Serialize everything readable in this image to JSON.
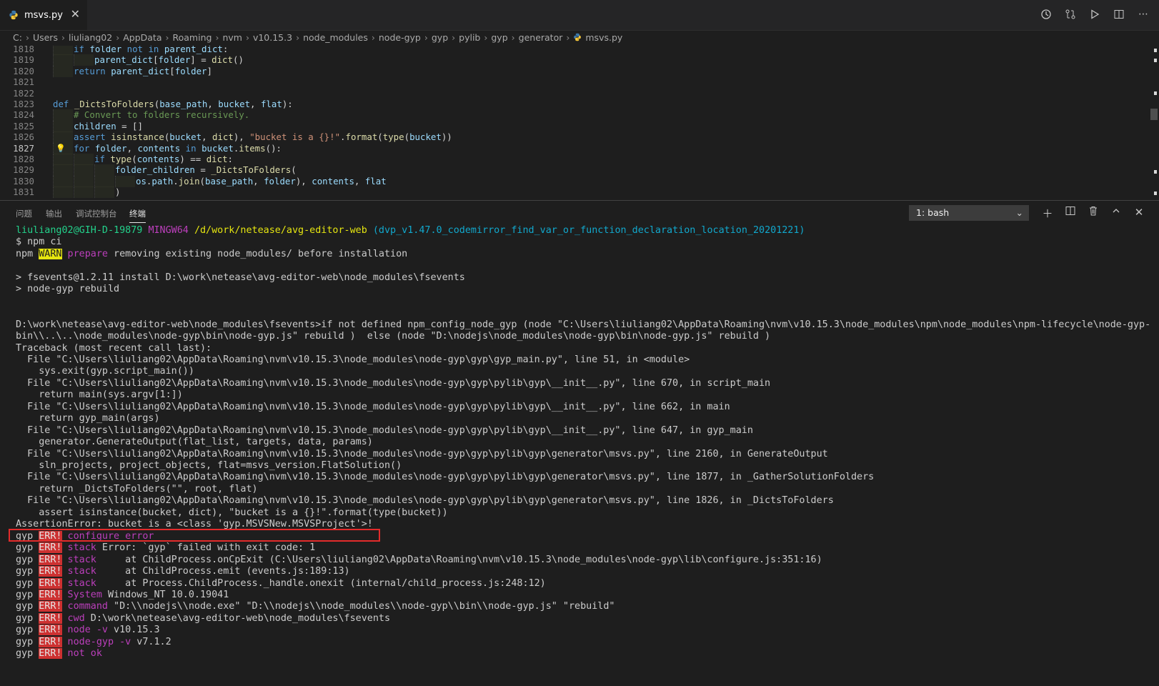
{
  "tab": {
    "file_name": "msvs.py",
    "close": "✕"
  },
  "breadcrumb": [
    "C:",
    "Users",
    "liuliang02",
    "AppData",
    "Roaming",
    "nvm",
    "v10.15.3",
    "node_modules",
    "node-gyp",
    "gyp",
    "pylib",
    "gyp",
    "generator",
    "msvs.py"
  ],
  "editor": {
    "lines": [
      {
        "n": "1818",
        "tokens": [
          [
            "kw",
            "if "
          ],
          [
            "id",
            "folder "
          ],
          [
            "kw",
            "not in "
          ],
          [
            "id",
            "parent_dict"
          ],
          [
            "op",
            ":"
          ]
        ],
        "indent": 1
      },
      {
        "n": "1819",
        "tokens": [
          [
            "id",
            "parent_dict"
          ],
          [
            "op",
            "["
          ],
          [
            "id",
            "folder"
          ],
          [
            "op",
            "] = "
          ],
          [
            "fn",
            "dict"
          ],
          [
            "op",
            "()"
          ]
        ],
        "indent": 2
      },
      {
        "n": "1820",
        "tokens": [
          [
            "kw",
            "return "
          ],
          [
            "id",
            "parent_dict"
          ],
          [
            "op",
            "["
          ],
          [
            "id",
            "folder"
          ],
          [
            "op",
            "]"
          ]
        ],
        "indent": 1
      },
      {
        "n": "1821",
        "tokens": [],
        "indent": 0
      },
      {
        "n": "1822",
        "tokens": [],
        "indent": 0
      },
      {
        "n": "1823",
        "tokens": [
          [
            "kw",
            "def "
          ],
          [
            "fn",
            "_DictsToFolders"
          ],
          [
            "op",
            "("
          ],
          [
            "id",
            "base_path"
          ],
          [
            "op",
            ", "
          ],
          [
            "id",
            "bucket"
          ],
          [
            "op",
            ", "
          ],
          [
            "id",
            "flat"
          ],
          [
            "op",
            "):"
          ]
        ],
        "indent": 0
      },
      {
        "n": "1824",
        "tokens": [
          [
            "cm",
            "# Convert to folders recursively."
          ]
        ],
        "indent": 1
      },
      {
        "n": "1825",
        "tokens": [
          [
            "id",
            "children "
          ],
          [
            "op",
            "= []"
          ]
        ],
        "indent": 1
      },
      {
        "n": "1826",
        "tokens": [
          [
            "kw",
            "assert "
          ],
          [
            "fn",
            "isinstance"
          ],
          [
            "op",
            "("
          ],
          [
            "id",
            "bucket"
          ],
          [
            "op",
            ", "
          ],
          [
            "fn",
            "dict"
          ],
          [
            "op",
            "), "
          ],
          [
            "str",
            "\"bucket is a {}!\""
          ],
          [
            "op",
            "."
          ],
          [
            "fn",
            "format"
          ],
          [
            "op",
            "("
          ],
          [
            "fn",
            "type"
          ],
          [
            "op",
            "("
          ],
          [
            "id",
            "bucket"
          ],
          [
            "op",
            "))"
          ]
        ],
        "indent": 1
      },
      {
        "n": "1827",
        "tokens": [
          [
            "kw",
            "for "
          ],
          [
            "id",
            "folder"
          ],
          [
            "op",
            ", "
          ],
          [
            "id",
            "contents "
          ],
          [
            "kw",
            "in "
          ],
          [
            "id",
            "bucket"
          ],
          [
            "op",
            "."
          ],
          [
            "fn",
            "items"
          ],
          [
            "op",
            "():"
          ]
        ],
        "indent": 1,
        "active": true
      },
      {
        "n": "1828",
        "tokens": [
          [
            "kw",
            "if "
          ],
          [
            "fn",
            "type"
          ],
          [
            "op",
            "("
          ],
          [
            "id",
            "contents"
          ],
          [
            "op",
            ") == "
          ],
          [
            "fn",
            "dict"
          ],
          [
            "op",
            ":"
          ]
        ],
        "indent": 2
      },
      {
        "n": "1829",
        "tokens": [
          [
            "id",
            "folder_children "
          ],
          [
            "op",
            "= "
          ],
          [
            "fn",
            "_DictsToFolders"
          ],
          [
            "op",
            "("
          ]
        ],
        "indent": 3
      },
      {
        "n": "1830",
        "tokens": [
          [
            "id",
            "os"
          ],
          [
            "op",
            "."
          ],
          [
            "id",
            "path"
          ],
          [
            "op",
            "."
          ],
          [
            "fn",
            "join"
          ],
          [
            "op",
            "("
          ],
          [
            "id",
            "base_path"
          ],
          [
            "op",
            ", "
          ],
          [
            "id",
            "folder"
          ],
          [
            "op",
            "), "
          ],
          [
            "id",
            "contents"
          ],
          [
            "op",
            ", "
          ],
          [
            "id",
            "flat"
          ]
        ],
        "indent": 4
      },
      {
        "n": "1831",
        "tokens": [
          [
            "op",
            ")"
          ]
        ],
        "indent": 3
      }
    ]
  },
  "panel": {
    "tabs": [
      "问题",
      "输出",
      "调试控制台",
      "终端"
    ],
    "active_tab": "终端",
    "terminal_select": "1: bash"
  },
  "terminal": {
    "lines": [
      [
        [
          "green",
          "liuliang02@GIH-D-19879 "
        ],
        [
          "mag",
          "MINGW64 "
        ],
        [
          "yel",
          "/d/work/netease/avg-editor-web "
        ],
        [
          "cyan",
          "(dvp_v1.47.0_codemirror_find_var_or_function_declaration_location_20201221)"
        ]
      ],
      [
        [
          "",
          "$ npm ci"
        ]
      ],
      [
        [
          "",
          "npm "
        ],
        [
          "warnbg",
          "WARN"
        ],
        [
          "",
          ""
        ],
        [
          "prop",
          " prepare"
        ],
        [
          "",
          " removing existing node_modules/ before installation"
        ]
      ],
      [],
      [
        [
          "",
          "> fsevents@1.2.11 install D:\\work\\netease\\avg-editor-web\\node_modules\\fsevents"
        ]
      ],
      [
        [
          "",
          "> node-gyp rebuild"
        ]
      ],
      [],
      [],
      [
        [
          "",
          "D:\\work\\netease\\avg-editor-web\\node_modules\\fsevents>if not defined npm_config_node_gyp (node \"C:\\Users\\liuliang02\\AppData\\Roaming\\nvm\\v10.15.3\\node_modules\\npm\\node_modules\\npm-lifecycle\\node-gyp-"
        ]
      ],
      [
        [
          "",
          "bin\\\\..\\..\\node_modules\\node-gyp\\bin\\node-gyp.js\" rebuild )  else (node \"D:\\nodejs\\node_modules\\node-gyp\\bin\\node-gyp.js\" rebuild )"
        ]
      ],
      [
        [
          "",
          "Traceback (most recent call last):"
        ]
      ],
      [
        [
          "",
          "  File \"C:\\Users\\liuliang02\\AppData\\Roaming\\nvm\\v10.15.3\\node_modules\\node-gyp\\gyp\\gyp_main.py\", line 51, in <module>"
        ]
      ],
      [
        [
          "",
          "    sys.exit(gyp.script_main())"
        ]
      ],
      [
        [
          "",
          "  File \"C:\\Users\\liuliang02\\AppData\\Roaming\\nvm\\v10.15.3\\node_modules\\node-gyp\\gyp\\pylib\\gyp\\__init__.py\", line 670, in script_main"
        ]
      ],
      [
        [
          "",
          "    return main(sys.argv[1:])"
        ]
      ],
      [
        [
          "",
          "  File \"C:\\Users\\liuliang02\\AppData\\Roaming\\nvm\\v10.15.3\\node_modules\\node-gyp\\gyp\\pylib\\gyp\\__init__.py\", line 662, in main"
        ]
      ],
      [
        [
          "",
          "    return gyp_main(args)"
        ]
      ],
      [
        [
          "",
          "  File \"C:\\Users\\liuliang02\\AppData\\Roaming\\nvm\\v10.15.3\\node_modules\\node-gyp\\gyp\\pylib\\gyp\\__init__.py\", line 647, in gyp_main"
        ]
      ],
      [
        [
          "",
          "    generator.GenerateOutput(flat_list, targets, data, params)"
        ]
      ],
      [
        [
          "",
          "  File \"C:\\Users\\liuliang02\\AppData\\Roaming\\nvm\\v10.15.3\\node_modules\\node-gyp\\gyp\\pylib\\gyp\\generator\\msvs.py\", line 2160, in GenerateOutput"
        ]
      ],
      [
        [
          "",
          "    sln_projects, project_objects, flat=msvs_version.FlatSolution()"
        ]
      ],
      [
        [
          "",
          "  File \"C:\\Users\\liuliang02\\AppData\\Roaming\\nvm\\v10.15.3\\node_modules\\node-gyp\\gyp\\pylib\\gyp\\generator\\msvs.py\", line 1877, in _GatherSolutionFolders"
        ]
      ],
      [
        [
          "",
          "    return _DictsToFolders(\"\", root, flat)"
        ]
      ],
      [
        [
          "",
          "  File \"C:\\Users\\liuliang02\\AppData\\Roaming\\nvm\\v10.15.3\\node_modules\\node-gyp\\gyp\\pylib\\gyp\\generator\\msvs.py\", line 1826, in _DictsToFolders"
        ]
      ],
      [
        [
          "",
          "    assert isinstance(bucket, dict), \"bucket is a {}!\".format(type(bucket))"
        ]
      ],
      [
        [
          "",
          "AssertionError: bucket is a <class 'gyp.MSVSNew.MSVSProject'>!"
        ]
      ],
      [
        [
          "",
          "gyp "
        ],
        [
          "errbg",
          "ERR!"
        ],
        [
          "prop",
          " configure error"
        ]
      ],
      [
        [
          "",
          "gyp "
        ],
        [
          "errbg",
          "ERR!"
        ],
        [
          "prop",
          " stack"
        ],
        [
          "",
          " Error: `gyp` failed with exit code: 1"
        ]
      ],
      [
        [
          "",
          "gyp "
        ],
        [
          "errbg",
          "ERR!"
        ],
        [
          "prop",
          " stack"
        ],
        [
          "",
          "     at ChildProcess.onCpExit (C:\\Users\\liuliang02\\AppData\\Roaming\\nvm\\v10.15.3\\node_modules\\node-gyp\\lib\\configure.js:351:16)"
        ]
      ],
      [
        [
          "",
          "gyp "
        ],
        [
          "errbg",
          "ERR!"
        ],
        [
          "prop",
          " stack"
        ],
        [
          "",
          "     at ChildProcess.emit (events.js:189:13)"
        ]
      ],
      [
        [
          "",
          "gyp "
        ],
        [
          "errbg",
          "ERR!"
        ],
        [
          "prop",
          " stack"
        ],
        [
          "",
          "     at Process.ChildProcess._handle.onexit (internal/child_process.js:248:12)"
        ]
      ],
      [
        [
          "",
          "gyp "
        ],
        [
          "errbg",
          "ERR!"
        ],
        [
          "prop",
          " System"
        ],
        [
          "",
          " Windows_NT 10.0.19041"
        ]
      ],
      [
        [
          "",
          "gyp "
        ],
        [
          "errbg",
          "ERR!"
        ],
        [
          "prop",
          " command"
        ],
        [
          "",
          " \"D:\\\\nodejs\\\\node.exe\" \"D:\\\\nodejs\\\\node_modules\\\\node-gyp\\\\bin\\\\node-gyp.js\" \"rebuild\""
        ]
      ],
      [
        [
          "",
          "gyp "
        ],
        [
          "errbg",
          "ERR!"
        ],
        [
          "prop",
          " cwd"
        ],
        [
          "",
          " D:\\work\\netease\\avg-editor-web\\node_modules\\fsevents"
        ]
      ],
      [
        [
          "",
          "gyp "
        ],
        [
          "errbg",
          "ERR!"
        ],
        [
          "prop",
          " node -v"
        ],
        [
          "",
          " v10.15.3"
        ]
      ],
      [
        [
          "",
          "gyp "
        ],
        [
          "errbg",
          "ERR!"
        ],
        [
          "prop",
          " node-gyp -v"
        ],
        [
          "",
          " v7.1.2"
        ]
      ],
      [
        [
          "",
          "gyp "
        ],
        [
          "errbg",
          "ERR!"
        ],
        [
          "prop",
          " not ok"
        ]
      ]
    ]
  }
}
